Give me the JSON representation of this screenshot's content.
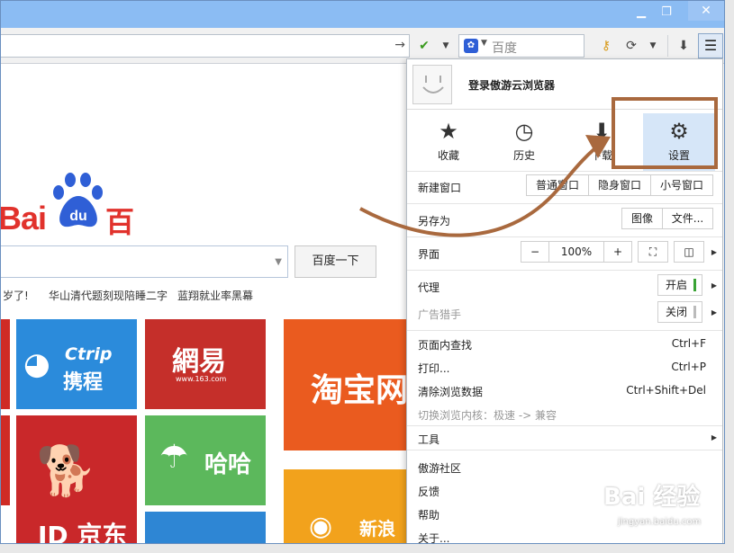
{
  "search": {
    "placeholder": "百度"
  },
  "baidu": {
    "logo_bai": "Bai",
    "logo_du": "du",
    "logo_cn": "百度",
    "button": "百度一下",
    "hot": [
      "岁了!",
      "华山清代题刻现陪睡二字",
      "蓝翔就业率黑幕"
    ]
  },
  "tiles": {
    "ctrip_en": "Ctrip",
    "ctrip_cn": "携程",
    "wy_cn": "網易",
    "wy_sub": "www.163.com",
    "taobao": "淘宝网",
    "haha": "哈哈",
    "jd": "JD 京东",
    "sina": "新浪微"
  },
  "menu": {
    "login": "登录傲游云浏览器",
    "quick": [
      {
        "icon": "★",
        "label": "收藏"
      },
      {
        "icon": "◷",
        "label": "历史"
      },
      {
        "icon": "⬇",
        "label": "下载"
      },
      {
        "icon": "⚙",
        "label": "设置"
      }
    ],
    "new_window": {
      "label": "新建窗口",
      "opts": [
        "普通窗口",
        "隐身窗口",
        "小号窗口"
      ]
    },
    "save_as": {
      "label": "另存为",
      "opts": [
        "图像",
        "文件..."
      ]
    },
    "ui": {
      "label": "界面",
      "minus": "−",
      "zoom": "100%",
      "plus": "+"
    },
    "proxy": {
      "label": "代理",
      "state": "开启"
    },
    "adblock": {
      "label": "广告猎手",
      "state": "关闭"
    },
    "items": [
      {
        "label": "页面内查找",
        "key": "Ctrl+F"
      },
      {
        "label": "打印...",
        "key": "Ctrl+P"
      },
      {
        "label": "清除浏览数据",
        "key": "Ctrl+Shift+Del"
      }
    ],
    "switch_core": "切换浏览内核：极速 -> 兼容",
    "tools": "工具",
    "bottom": [
      "傲游社区",
      "反馈",
      "帮助",
      "关于..."
    ]
  },
  "watermark": {
    "main": "Bai 经验",
    "url": "jingyan.baidu.com"
  },
  "colors": {
    "accent": "#a9693e",
    "baidu_red": "#e1322c",
    "baidu_blue": "#2f5fd6",
    "titlebar": "#8bbcf3"
  }
}
